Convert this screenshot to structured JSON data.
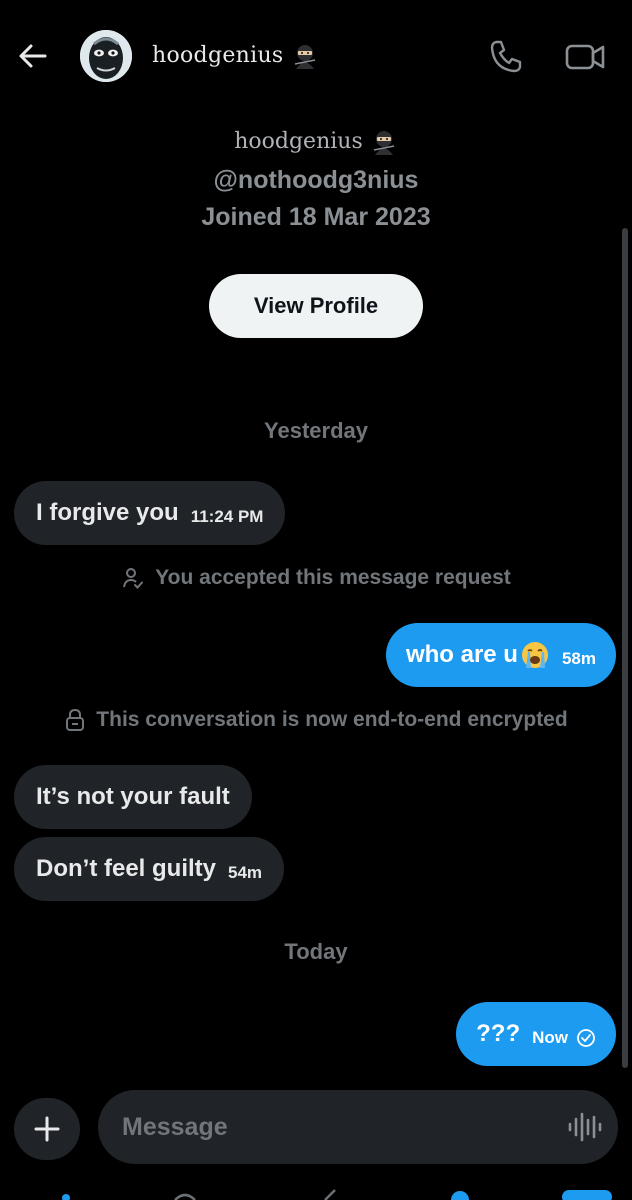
{
  "header": {
    "name": "hoodgenius",
    "name_emoji": "ninja-icon",
    "icons": [
      "back-arrow-icon",
      "phone-icon",
      "video-camera-icon"
    ]
  },
  "profile": {
    "name": "hoodgenius",
    "handle": "@nothoodg3nius",
    "joined": "Joined 18 Mar 2023",
    "view_profile_label": "View Profile"
  },
  "conversation": {
    "day1": "Yesterday",
    "msg1": {
      "text": "I forgive you",
      "time": "11:24 PM"
    },
    "sys1": "You accepted this message request",
    "msg2": {
      "text": "who are u",
      "emoji": "loudly-crying-face",
      "time": "58m"
    },
    "sys2": "This conversation is now end-to-end encrypted",
    "msg3": {
      "text": "It’s not your fault"
    },
    "msg4": {
      "text": "Don’t feel guilty",
      "time": "54m"
    },
    "day2": "Today",
    "msg5": {
      "text": "???",
      "time": "Now",
      "status": "sent-check-icon"
    }
  },
  "composer": {
    "placeholder": "Message"
  },
  "colors": {
    "background": "#000000",
    "accent": "#1d9bf0",
    "incoming_bubble": "#202327",
    "muted_text": "#71767b"
  }
}
